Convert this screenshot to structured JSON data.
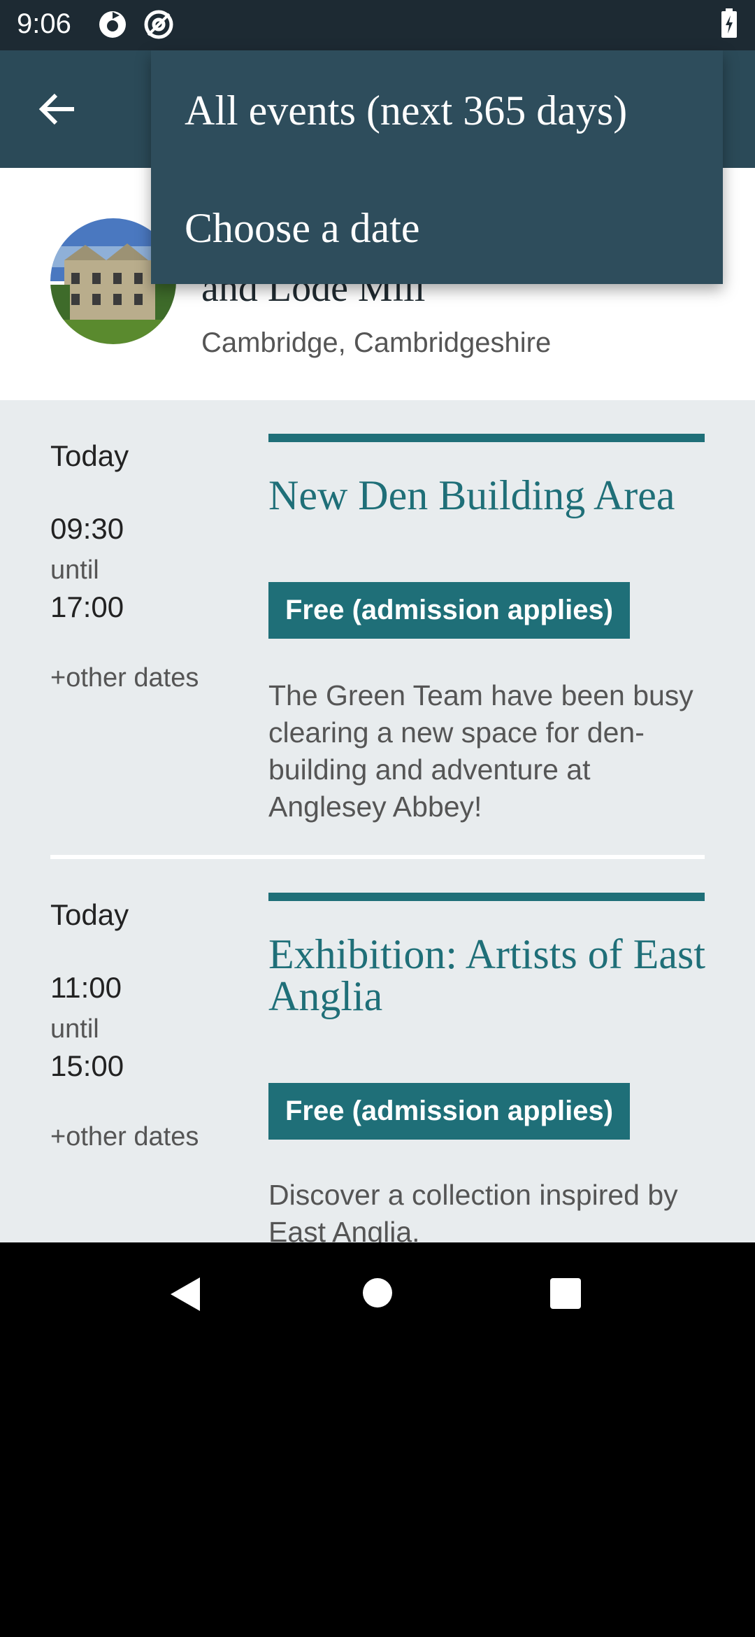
{
  "status_bar": {
    "time": "9:06"
  },
  "header": {
    "place_name_visible": "and Lode Mill",
    "location": "Cambridge, Cambridgeshire"
  },
  "menu": {
    "items": [
      {
        "label": "All events (next 365 days)"
      },
      {
        "label": "Choose a date"
      }
    ]
  },
  "events": [
    {
      "day": "Today",
      "start": "09:30",
      "until": "until",
      "end": "17:00",
      "other_dates": "+other dates",
      "title": "New Den Building Area",
      "price": "Free (admission applies)",
      "description": "The Green Team have been busy clearing a new space for den-building and adventure at Anglesey Abbey!"
    },
    {
      "day": "Today",
      "start": "11:00",
      "until": "until",
      "end": "15:00",
      "other_dates": "+other dates",
      "title": "Exhibition: Artists of East Anglia",
      "price": "Free (admission applies)",
      "description": "Discover a collection inspired by East Anglia."
    }
  ],
  "colors": {
    "accent": "#1f6f78",
    "app_bar": "#2b4a58",
    "menu_bg": "#2e4d5c",
    "content_bg": "#e8ecee"
  },
  "icons": {
    "back": "arrow-left-icon",
    "nav_back": "triangle-back-icon",
    "nav_home": "circle-home-icon",
    "nav_recents": "square-recents-icon"
  }
}
